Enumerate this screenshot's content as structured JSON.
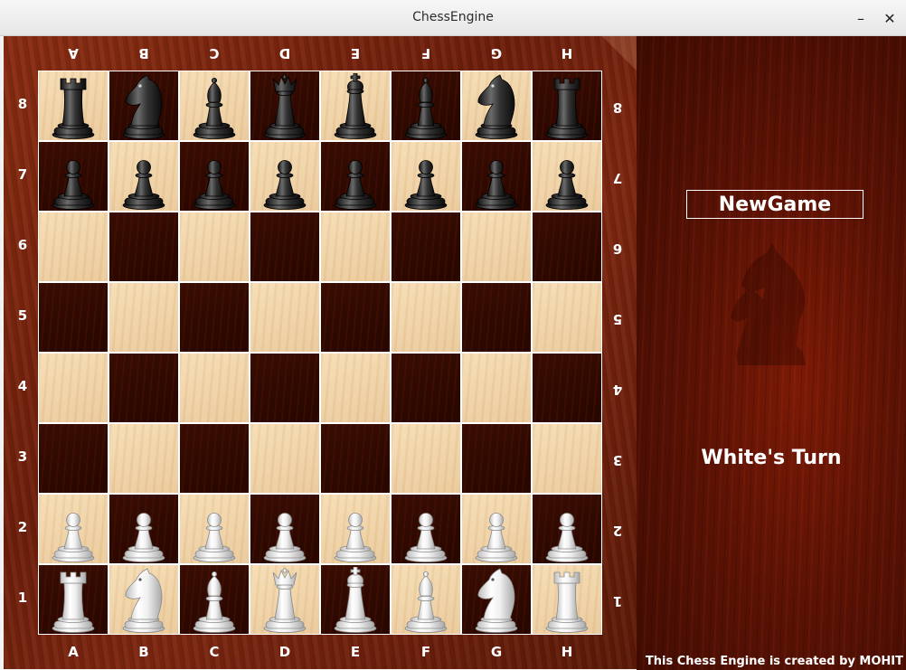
{
  "window": {
    "title": "ChessEngine",
    "minimize_symbol": "–",
    "close_symbol": "✕"
  },
  "board": {
    "files": [
      "A",
      "B",
      "C",
      "D",
      "E",
      "F",
      "G",
      "H"
    ],
    "ranks": [
      "8",
      "7",
      "6",
      "5",
      "4",
      "3",
      "2",
      "1"
    ],
    "position": [
      [
        "br",
        "bn",
        "bb",
        "bq",
        "bk",
        "bb",
        "bn",
        "br"
      ],
      [
        "bp",
        "bp",
        "bp",
        "bp",
        "bp",
        "bp",
        "bp",
        "bp"
      ],
      [
        "",
        "",
        "",
        "",
        "",
        "",
        "",
        ""
      ],
      [
        "",
        "",
        "",
        "",
        "",
        "",
        "",
        ""
      ],
      [
        "",
        "",
        "",
        "",
        "",
        "",
        "",
        ""
      ],
      [
        "",
        "",
        "",
        "",
        "",
        "",
        "",
        ""
      ],
      [
        "wp",
        "wp",
        "wp",
        "wp",
        "wp",
        "wp",
        "wp",
        "wp"
      ],
      [
        "wr",
        "wn",
        "wb",
        "wq",
        "wk",
        "wb",
        "wn",
        "wr"
      ]
    ],
    "piece_names": {
      "p": "pawn",
      "r": "rook",
      "n": "knight",
      "b": "bishop",
      "q": "queen",
      "k": "king"
    },
    "colors": {
      "light_square": "#f1d6ab",
      "dark_square": "#330a00",
      "frame": "#7a2510",
      "white_piece": "#f4f4f4",
      "black_piece": "#3a3a3a"
    }
  },
  "panel": {
    "new_game_label": "NewGame",
    "turn_text": "White's Turn",
    "credit_text": "This Chess Engine is created by MOHIT",
    "background": "#5a1204"
  }
}
